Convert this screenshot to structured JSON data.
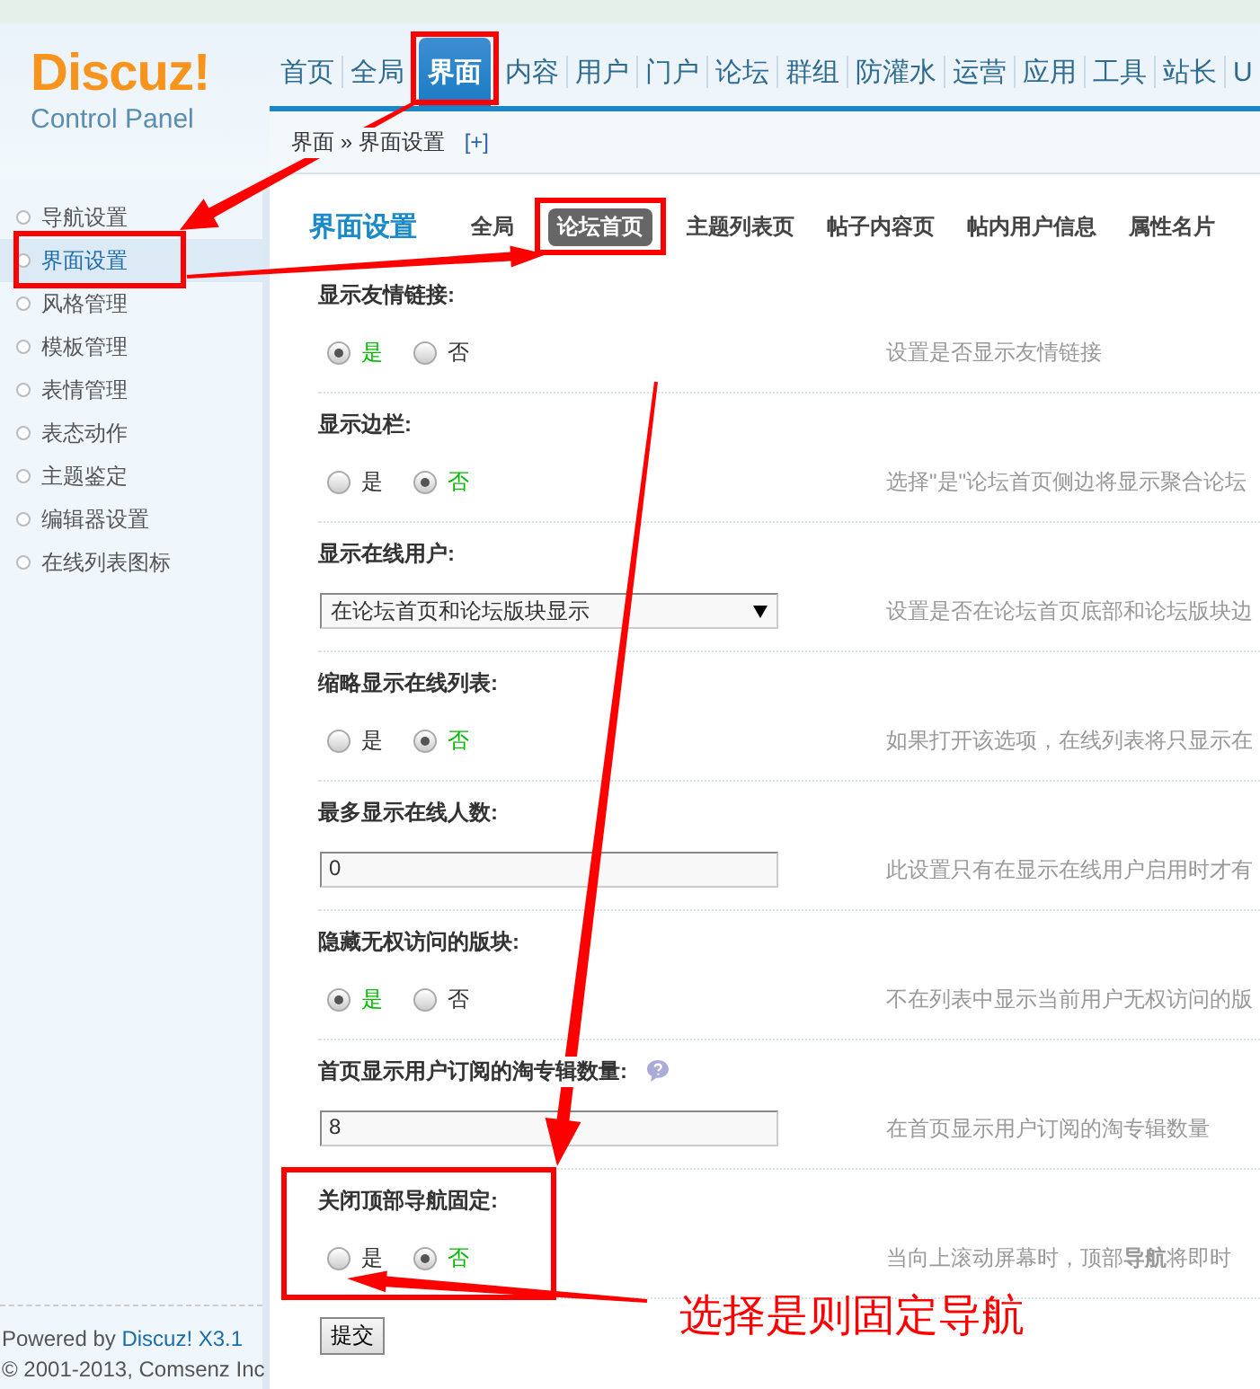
{
  "logo": {
    "name": "Discuz!",
    "subtitle": "Control Panel"
  },
  "nav": [
    {
      "label": "首页",
      "selected": false
    },
    {
      "label": "全局",
      "selected": false
    },
    {
      "label": "界面",
      "selected": true
    },
    {
      "label": "内容",
      "selected": false
    },
    {
      "label": "用户",
      "selected": false
    },
    {
      "label": "门户",
      "selected": false
    },
    {
      "label": "论坛",
      "selected": false
    },
    {
      "label": "群组",
      "selected": false
    },
    {
      "label": "防灌水",
      "selected": false
    },
    {
      "label": "运营",
      "selected": false
    },
    {
      "label": "应用",
      "selected": false
    },
    {
      "label": "工具",
      "selected": false
    },
    {
      "label": "站长",
      "selected": false
    },
    {
      "label": "U",
      "selected": false
    }
  ],
  "breadcrumb": {
    "path": [
      "界面",
      "界面设置"
    ],
    "separator": "»",
    "add": "[+]"
  },
  "sidebar": {
    "items": [
      {
        "label": "导航设置",
        "selected": false
      },
      {
        "label": "界面设置",
        "selected": true
      },
      {
        "label": "风格管理",
        "selected": false
      },
      {
        "label": "模板管理",
        "selected": false
      },
      {
        "label": "表情管理",
        "selected": false
      },
      {
        "label": "表态动作",
        "selected": false
      },
      {
        "label": "主题鉴定",
        "selected": false
      },
      {
        "label": "编辑器设置",
        "selected": false
      },
      {
        "label": "在线列表图标",
        "selected": false
      }
    ]
  },
  "page": {
    "title": "界面设置",
    "tabs": [
      {
        "label": "全局",
        "selected": false
      },
      {
        "label": "论坛首页",
        "selected": true
      },
      {
        "label": "主题列表页",
        "selected": false
      },
      {
        "label": "帖子内容页",
        "selected": false
      },
      {
        "label": "帖内用户信息",
        "selected": false
      },
      {
        "label": "属性名片",
        "selected": false
      }
    ]
  },
  "settings": [
    {
      "label": "显示友情链接:",
      "kind": "radio",
      "options": [
        {
          "label": "是",
          "selected": true
        },
        {
          "label": "否",
          "selected": false
        }
      ],
      "description": "设置是否显示友情链接"
    },
    {
      "label": "显示边栏:",
      "kind": "radio",
      "options": [
        {
          "label": "是",
          "selected": false
        },
        {
          "label": "否",
          "selected": true
        }
      ],
      "description": "选择\"是\"论坛首页侧边将显示聚合论坛"
    },
    {
      "label": "显示在线用户:",
      "kind": "select",
      "value": "在论坛首页和论坛版块显示",
      "description": "设置是否在论坛首页底部和论坛版块边"
    },
    {
      "label": "缩略显示在线列表:",
      "kind": "radio",
      "options": [
        {
          "label": "是",
          "selected": false
        },
        {
          "label": "否",
          "selected": true
        }
      ],
      "description": "如果打开该选项，在线列表将只显示在"
    },
    {
      "label": "最多显示在线人数:",
      "kind": "text",
      "value": "0",
      "description": "此设置只有在显示在线用户启用时才有"
    },
    {
      "label": "隐藏无权访问的版块:",
      "kind": "radio",
      "options": [
        {
          "label": "是",
          "selected": true
        },
        {
          "label": "否",
          "selected": false
        }
      ],
      "description": "不在列表中显示当前用户无权访问的版"
    },
    {
      "label": "首页显示用户订阅的淘专辑数量:",
      "kind": "text",
      "value": "8",
      "help": true,
      "description": "在首页显示用户订阅的淘专辑数量"
    },
    {
      "label": "关闭顶部**导航**固定:",
      "kind": "radio",
      "options": [
        {
          "label": "是",
          "selected": false
        },
        {
          "label": "否",
          "selected": true
        }
      ],
      "description": "当向上滚动屏幕时，顶部**导航**将即时"
    }
  ],
  "submit": "提交",
  "footer": {
    "powered": "Powered by",
    "link": "Discuz! X3.1",
    "copyright": "© 2001-2013, Comsenz Inc"
  },
  "annotation": {
    "text": "选择是则固定导航"
  }
}
